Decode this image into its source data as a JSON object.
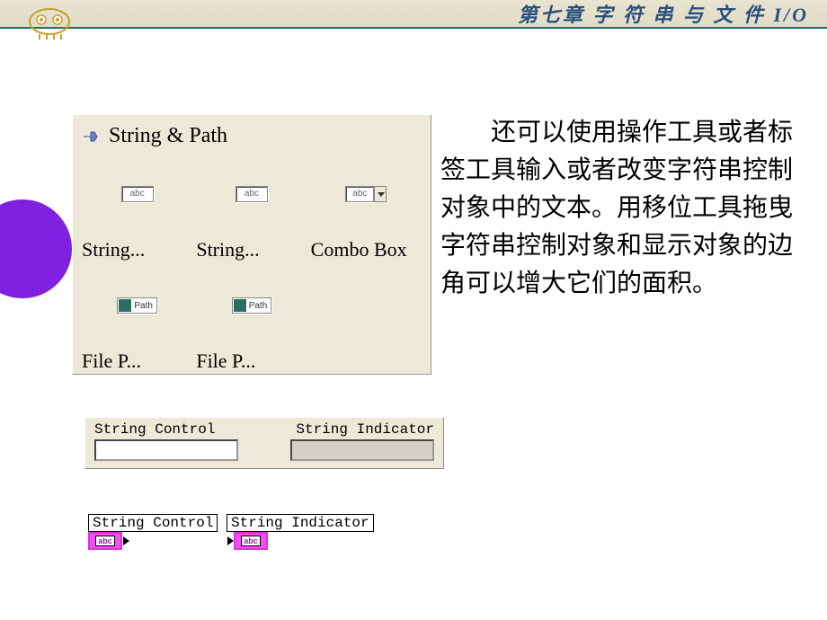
{
  "header": {
    "title": "第七章  字 符 串 与 文 件 I/O"
  },
  "palette": {
    "title": "String & Path",
    "items": [
      {
        "icon_text": "abc",
        "label": "String..."
      },
      {
        "icon_text": "abc",
        "label": "String..."
      },
      {
        "icon_text": "abc",
        "label": "Combo Box"
      },
      {
        "icon_text": "Path",
        "label": "File P..."
      },
      {
        "icon_text": "Path",
        "label": "File P..."
      }
    ]
  },
  "controls_panel": {
    "control_label": "String Control",
    "indicator_label": "String Indicator"
  },
  "terminals": {
    "control_label": "String Control",
    "control_icon_text": "abc",
    "indicator_label": "String Indicator",
    "indicator_icon_text": "abc"
  },
  "body_text": "还可以使用操作工具或者标签工具输入或者改变字符串控制对象中的文本。用移位工具拖曳字符串控制对象和显示对象的边角可以增大它们的面积。"
}
